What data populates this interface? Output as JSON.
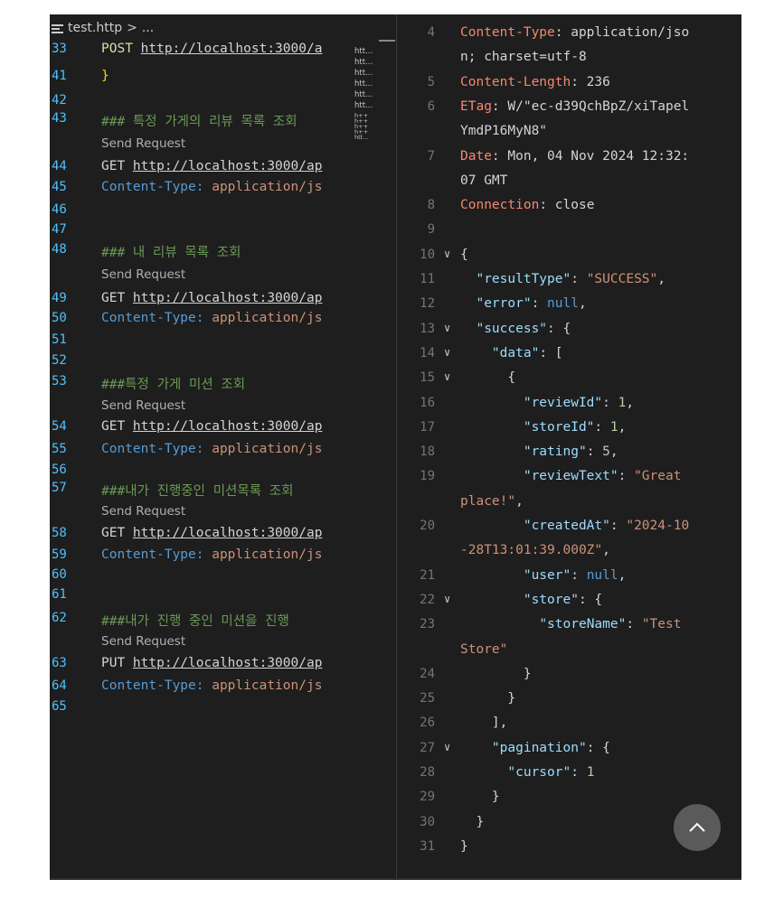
{
  "breadcrumb": {
    "file": "test.http",
    "sep": ">",
    "more": "..."
  },
  "left_lines": [
    {
      "num": "33",
      "parts": [
        [
          "kw-post",
          "POST "
        ],
        [
          "url",
          "http://localhost:3000/a"
        ]
      ]
    },
    {
      "num": "41",
      "parts": [
        [
          "brace-y",
          "}"
        ]
      ]
    },
    {
      "num": "42",
      "parts": []
    },
    {
      "num": "43",
      "parts": [
        [
          "cmt",
          "### 특정 가게의 리뷰 목록 조회"
        ]
      ]
    },
    {
      "num": "",
      "send": "Send Request"
    },
    {
      "num": "44",
      "parts": [
        [
          "kw",
          "GET "
        ],
        [
          "url",
          "http://localhost:3000/ap"
        ]
      ]
    },
    {
      "num": "45",
      "parts": [
        [
          "hdr",
          "Content-Type: "
        ],
        [
          "hval",
          "application/js"
        ]
      ]
    },
    {
      "num": "46",
      "parts": []
    },
    {
      "num": "47",
      "parts": []
    },
    {
      "num": "48",
      "parts": [
        [
          "cmt",
          "### 내 리뷰 목록 조회"
        ]
      ]
    },
    {
      "num": "",
      "send": "Send Request"
    },
    {
      "num": "49",
      "parts": [
        [
          "kw",
          "GET "
        ],
        [
          "url",
          "http://localhost:3000/ap"
        ]
      ]
    },
    {
      "num": "50",
      "parts": [
        [
          "hdr",
          "Content-Type: "
        ],
        [
          "hval",
          "application/js"
        ]
      ]
    },
    {
      "num": "51",
      "parts": []
    },
    {
      "num": "52",
      "parts": []
    },
    {
      "num": "53",
      "parts": [
        [
          "cmt",
          "###특정 가게 미션 조회"
        ]
      ]
    },
    {
      "num": "",
      "send": "Send Request"
    },
    {
      "num": "54",
      "parts": [
        [
          "kw",
          "GET "
        ],
        [
          "url",
          "http://localhost:3000/ap"
        ]
      ]
    },
    {
      "num": "55",
      "parts": [
        [
          "hdr",
          "Content-Type: "
        ],
        [
          "hval",
          "application/js"
        ]
      ]
    },
    {
      "num": "56",
      "parts": []
    },
    {
      "num": "57",
      "parts": [
        [
          "cmt",
          "###내가 진행중인 미션목록 조회"
        ]
      ]
    },
    {
      "num": "",
      "send": "Send Request"
    },
    {
      "num": "58",
      "parts": [
        [
          "kw",
          "GET "
        ],
        [
          "url",
          "http://localhost:3000/ap"
        ]
      ]
    },
    {
      "num": "59",
      "parts": [
        [
          "hdr",
          "Content-Type: "
        ],
        [
          "hval",
          "application/js"
        ]
      ]
    },
    {
      "num": "60",
      "parts": []
    },
    {
      "num": "61",
      "parts": []
    },
    {
      "num": "62",
      "parts": [
        [
          "cmt",
          "###내가 진행 중인 미션을 진행"
        ]
      ]
    },
    {
      "num": "",
      "send": "Send Request"
    },
    {
      "num": "63",
      "parts": [
        [
          "kw",
          "PUT "
        ],
        [
          "url",
          "http://localhost:3000/ap"
        ]
      ]
    },
    {
      "num": "64",
      "parts": [
        [
          "hdr",
          "Content-Type: "
        ],
        [
          "hval",
          "application/js"
        ]
      ]
    },
    {
      "num": "65",
      "parts": []
    }
  ],
  "minimap_lines": [
    "htt...",
    "htt...",
    "htt...",
    "htt...",
    "htt...",
    "htt...",
    "h++",
    "h++",
    "h++",
    "h++",
    "htt..."
  ],
  "right_lines": [
    {
      "num": "4",
      "parts": [
        [
          "hname",
          "Content-Type"
        ],
        [
          "hv",
          ": application/jso"
        ]
      ]
    },
    {
      "num": "",
      "parts": [
        [
          "hv",
          "n; charset=utf-8"
        ]
      ]
    },
    {
      "num": "5",
      "parts": [
        [
          "hname",
          "Content-Length"
        ],
        [
          "hv",
          ": 236"
        ]
      ]
    },
    {
      "num": "6",
      "parts": [
        [
          "hname",
          "ETag"
        ],
        [
          "hv",
          ": W/\"ec-d39QchBpZ/xiTapel"
        ]
      ]
    },
    {
      "num": "",
      "parts": [
        [
          "hv",
          "YmdP16MyN8\""
        ]
      ]
    },
    {
      "num": "7",
      "parts": [
        [
          "hname",
          "Date"
        ],
        [
          "hv",
          ": Mon, 04 Nov 2024 12:32:"
        ]
      ]
    },
    {
      "num": "",
      "parts": [
        [
          "hv",
          "07 GMT"
        ]
      ]
    },
    {
      "num": "8",
      "parts": [
        [
          "hname",
          "Connection"
        ],
        [
          "hv",
          ": close"
        ]
      ]
    },
    {
      "num": "9",
      "parts": []
    },
    {
      "num": "10",
      "fold": true,
      "parts": [
        [
          "jp",
          "{"
        ]
      ]
    },
    {
      "num": "11",
      "parts": [
        [
          "jp",
          "  "
        ],
        [
          "jk",
          "\"resultType\""
        ],
        [
          "jp",
          ": "
        ],
        [
          "js",
          "\"SUCCESS\""
        ],
        [
          "jp",
          ","
        ]
      ]
    },
    {
      "num": "12",
      "parts": [
        [
          "jp",
          "  "
        ],
        [
          "jk",
          "\"error\""
        ],
        [
          "jp",
          ": "
        ],
        [
          "jl",
          "null"
        ],
        [
          "jp",
          ","
        ]
      ]
    },
    {
      "num": "13",
      "fold": true,
      "parts": [
        [
          "jp",
          "  "
        ],
        [
          "jk",
          "\"success\""
        ],
        [
          "jp",
          ": {"
        ]
      ]
    },
    {
      "num": "14",
      "fold": true,
      "parts": [
        [
          "jp",
          "    "
        ],
        [
          "jk",
          "\"data\""
        ],
        [
          "jp",
          ": ["
        ]
      ]
    },
    {
      "num": "15",
      "fold": true,
      "parts": [
        [
          "jp",
          "      {"
        ]
      ]
    },
    {
      "num": "16",
      "parts": [
        [
          "jp",
          "        "
        ],
        [
          "jk",
          "\"reviewId\""
        ],
        [
          "jp",
          ": "
        ],
        [
          "jn",
          "1"
        ],
        [
          "jp",
          ","
        ]
      ]
    },
    {
      "num": "17",
      "parts": [
        [
          "jp",
          "        "
        ],
        [
          "jk",
          "\"storeId\""
        ],
        [
          "jp",
          ": "
        ],
        [
          "jn",
          "1"
        ],
        [
          "jp",
          ","
        ]
      ]
    },
    {
      "num": "18",
      "parts": [
        [
          "jp",
          "        "
        ],
        [
          "jk",
          "\"rating\""
        ],
        [
          "jp",
          ": "
        ],
        [
          "jn",
          "5"
        ],
        [
          "jp",
          ","
        ]
      ]
    },
    {
      "num": "19",
      "parts": [
        [
          "jp",
          "        "
        ],
        [
          "jk",
          "\"reviewText\""
        ],
        [
          "jp",
          ": "
        ],
        [
          "js",
          "\"Great"
        ]
      ]
    },
    {
      "num": "",
      "parts": [
        [
          "js",
          "place!\""
        ],
        [
          "jp",
          ","
        ]
      ]
    },
    {
      "num": "20",
      "parts": [
        [
          "jp",
          "        "
        ],
        [
          "jk",
          "\"createdAt\""
        ],
        [
          "jp",
          ": "
        ],
        [
          "js",
          "\"2024-10"
        ]
      ]
    },
    {
      "num": "",
      "parts": [
        [
          "js",
          "-28T13:01:39.000Z\""
        ],
        [
          "jp",
          ","
        ]
      ]
    },
    {
      "num": "21",
      "parts": [
        [
          "jp",
          "        "
        ],
        [
          "jk",
          "\"user\""
        ],
        [
          "jp",
          ": "
        ],
        [
          "jl",
          "null"
        ],
        [
          "jp",
          ","
        ]
      ]
    },
    {
      "num": "22",
      "fold": true,
      "parts": [
        [
          "jp",
          "        "
        ],
        [
          "jk",
          "\"store\""
        ],
        [
          "jp",
          ": {"
        ]
      ]
    },
    {
      "num": "23",
      "parts": [
        [
          "jp",
          "          "
        ],
        [
          "jk",
          "\"storeName\""
        ],
        [
          "jp",
          ": "
        ],
        [
          "js",
          "\"Test"
        ]
      ]
    },
    {
      "num": "",
      "parts": [
        [
          "js",
          "Store\""
        ]
      ]
    },
    {
      "num": "24",
      "parts": [
        [
          "jp",
          "        }"
        ]
      ]
    },
    {
      "num": "25",
      "parts": [
        [
          "jp",
          "      }"
        ]
      ]
    },
    {
      "num": "26",
      "parts": [
        [
          "jp",
          "    ],"
        ]
      ]
    },
    {
      "num": "27",
      "fold": true,
      "parts": [
        [
          "jp",
          "    "
        ],
        [
          "jk",
          "\"pagination\""
        ],
        [
          "jp",
          ": {"
        ]
      ]
    },
    {
      "num": "28",
      "parts": [
        [
          "jp",
          "      "
        ],
        [
          "jk",
          "\"cursor\""
        ],
        [
          "jp",
          ": "
        ],
        [
          "jn",
          "1"
        ]
      ]
    },
    {
      "num": "29",
      "parts": [
        [
          "jp",
          "    }"
        ]
      ]
    },
    {
      "num": "30",
      "parts": [
        [
          "jp",
          "  }"
        ]
      ]
    },
    {
      "num": "31",
      "parts": [
        [
          "jp",
          "}"
        ]
      ]
    }
  ],
  "scroll_top_icon": "chevron-up-icon",
  "colors": {
    "editor_bg": "#1e1e1e",
    "line_number": "#4fc1ff",
    "comment": "#6a9955",
    "header_name": "#f48771",
    "json_key": "#9cdcfe",
    "json_string": "#ce9178"
  }
}
